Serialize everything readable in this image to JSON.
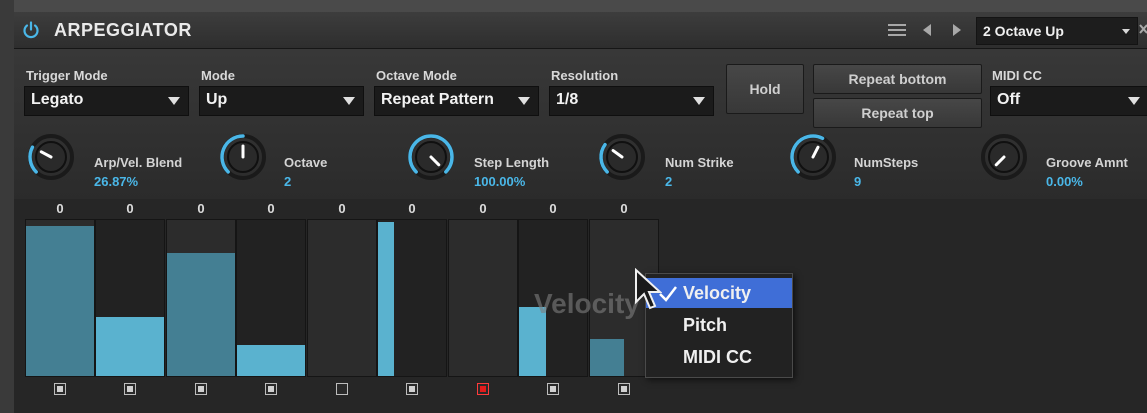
{
  "header": {
    "title": "ARPEGGIATOR",
    "preset": "2 Octave Up",
    "icons": [
      "power-icon",
      "menu-icon",
      "previous-preset-icon",
      "next-preset-icon",
      "dropdown-arrow-icon",
      "close-icon"
    ]
  },
  "controls": {
    "trigger_mode": {
      "label": "Trigger Mode",
      "value": "Legato"
    },
    "mode": {
      "label": "Mode",
      "value": "Up"
    },
    "octave_mode": {
      "label": "Octave Mode",
      "value": "Repeat Pattern"
    },
    "resolution": {
      "label": "Resolution",
      "value": "1/8"
    },
    "hold_label": "Hold",
    "repeat_bottom_label": "Repeat bottom",
    "repeat_top_label": "Repeat top",
    "midi_cc": {
      "label": "MIDI CC",
      "value": "Off"
    }
  },
  "knobs": [
    {
      "name": "Arp/Vel. Blend",
      "value": "26.87%",
      "level": 0.27
    },
    {
      "name": "Octave",
      "value": "2",
      "level": 0.5
    },
    {
      "name": "Step Length",
      "value": "100.00%",
      "level": 1.0
    },
    {
      "name": "Num Strike",
      "value": "2",
      "level": 0.3
    },
    {
      "name": "NumSteps",
      "value": "9",
      "level": 0.6
    },
    {
      "name": "Groove Amnt",
      "value": "0.00%",
      "level": 0.0
    }
  ],
  "steps": {
    "top_values": [
      "0",
      "0",
      "0",
      "0",
      "0",
      "0",
      "0",
      "0",
      "0"
    ],
    "bars": [
      {
        "level": 0.96,
        "width_frac": 1.0,
        "dark": true
      },
      {
        "level": 0.38,
        "width_frac": 1.0,
        "dark": false
      },
      {
        "level": 0.79,
        "width_frac": 1.0,
        "dark": true
      },
      {
        "level": 0.2,
        "width_frac": 1.0,
        "dark": false
      },
      {
        "level": 0.0,
        "width_frac": 1.0,
        "dark": false
      },
      {
        "level": 0.99,
        "width_frac": 0.23,
        "dark": false
      },
      {
        "level": 0.0,
        "width_frac": 1.0,
        "dark": false
      },
      {
        "level": 0.44,
        "width_frac": 0.4,
        "dark": false
      },
      {
        "level": 0.24,
        "width_frac": 0.5,
        "dark": true
      }
    ],
    "checks": [
      "on",
      "on",
      "on",
      "on",
      "off",
      "on",
      "red",
      "on",
      "on"
    ]
  },
  "lane_label": "Velocity",
  "context_menu": {
    "items": [
      "Velocity",
      "Pitch",
      "MIDI CC"
    ],
    "selected": "Velocity"
  },
  "colors": {
    "accent": "#4ab7e8",
    "bar": "#5ab2cf",
    "menu_selected": "#3f6ed7",
    "active_step": "#e21b1b"
  }
}
